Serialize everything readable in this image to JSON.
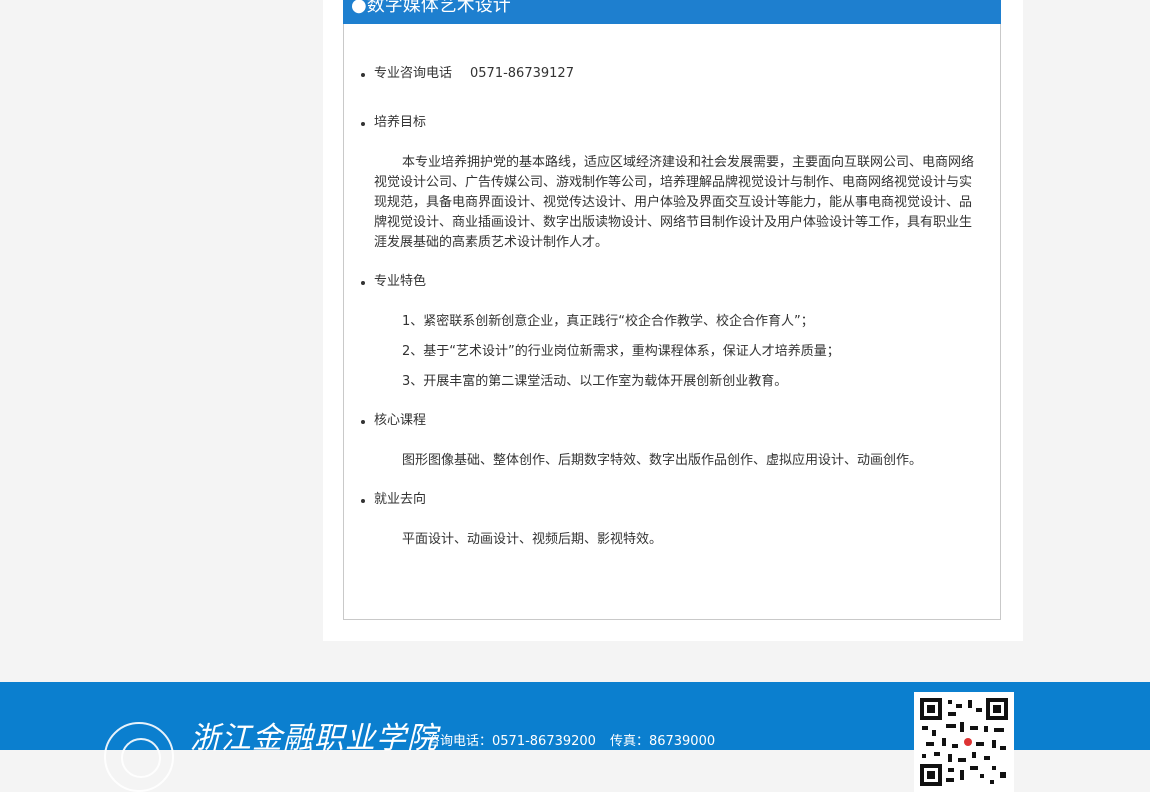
{
  "major": {
    "title": "●数字媒体艺术设计"
  },
  "sections": {
    "phone": {
      "label": "专业咨询电话",
      "value": "0571-86739127"
    },
    "goal": {
      "label": "培养目标",
      "text": "本专业培养拥护党的基本路线，适应区域经济建设和社会发展需要，主要面向互联网公司、电商网络视觉设计公司、广告传媒公司、游戏制作等公司，培养理解品牌视觉设计与制作、电商网络视觉设计与实现规范，具备电商界面设计、视觉传达设计、用户体验及界面交互设计等能力，能从事电商视觉设计、品牌视觉设计、商业插画设计、数字出版读物设计、网络节目制作设计及用户体验设计等工作，具有职业生涯发展基础的高素质艺术设计制作人才。"
    },
    "features": {
      "label": "专业特色",
      "items": [
        "1、紧密联系创新创意企业，真正践行“校企合作教学、校企合作育人”；",
        "2、基于“艺术设计”的行业岗位新需求，重构课程体系，保证人才培养质量；",
        "3、开展丰富的第二课堂活动、以工作室为载体开展创新创业教育。"
      ]
    },
    "courses": {
      "label": "核心课程",
      "text": "图形图像基础、整体创作、后期数字特效、数字出版作品创作、虚拟应用设计、动画创作。"
    },
    "careers": {
      "label": "就业去向",
      "text": "平面设计、动画设计、视频后期、影视特效。"
    }
  },
  "footer": {
    "school_name": "浙江金融职业学院",
    "phone": "咨询电话：0571-86739200",
    "fax": "传真：86739000",
    "logo_icon": "school-emblem-icon",
    "qr_icon": "qr-code-icon"
  },
  "colors": {
    "accent": "#1e7fcf",
    "footer_bg": "#0b7fcf",
    "page_bg": "#f4f4f4"
  }
}
